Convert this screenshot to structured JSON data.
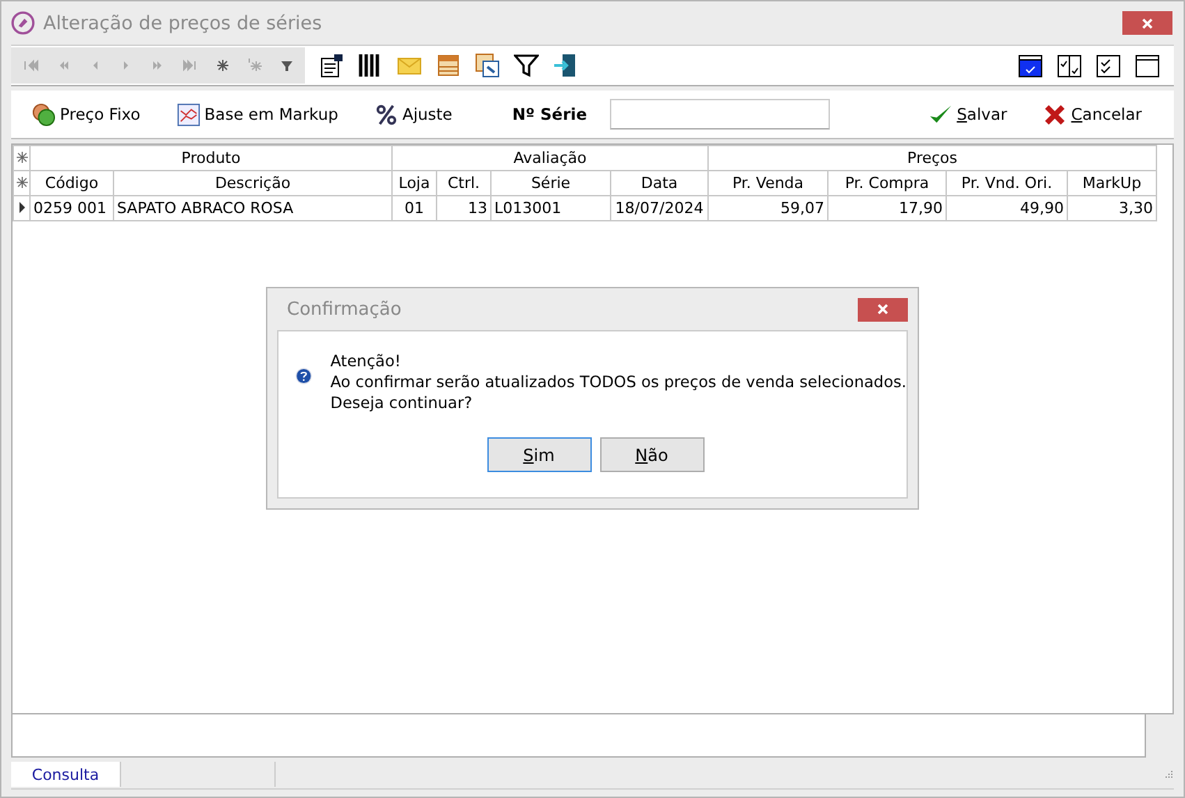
{
  "window": {
    "title": "Alteração de preços de séries"
  },
  "actions": [
    {
      "label": "Preço Fixo",
      "kind": "coins"
    },
    {
      "label": "Base em Markup",
      "kind": "chart"
    },
    {
      "label": "Ajuste",
      "kind": "percent"
    }
  ],
  "serial_field": {
    "label": "Nº Série"
  },
  "commit": [
    {
      "label": "Salvar",
      "kind": "save"
    },
    {
      "label": "Cancelar",
      "kind": "cancel"
    }
  ],
  "table": {
    "groups": [
      {
        "label": "Produto",
        "columns": [
          {
            "label": "Código"
          },
          {
            "label": "Descrição"
          }
        ]
      },
      {
        "label": "Avaliação",
        "columns": [
          {
            "label": "Loja"
          },
          {
            "label": "Ctrl."
          },
          {
            "label": "Série"
          },
          {
            "label": "Data"
          }
        ]
      },
      {
        "label": "Preços",
        "columns": [
          {
            "label": "Pr. Venda"
          },
          {
            "label": "Pr. Compra"
          },
          {
            "label": "Pr. Vnd. Ori."
          },
          {
            "label": "MarkUp"
          }
        ]
      }
    ],
    "rows": [
      {
        "selected": true,
        "cells": [
          "0259 001",
          "SAPATO ABRACO ROSA",
          "01",
          "13",
          "L013001",
          "18/07/2024",
          "59,07",
          "17,90",
          "49,90",
          "3,30"
        ]
      }
    ]
  },
  "status_bar": {
    "tabs": [
      {
        "label": "Consulta",
        "selected": true
      }
    ]
  },
  "dialog": {
    "title": "Confirmação",
    "lines": [
      "Atenção!",
      "Ao confirmar serão atualizados TODOS os preços de venda selecionados.",
      "Deseja continuar?"
    ],
    "buttons": [
      {
        "label": "Sim",
        "default": true
      },
      {
        "label": "Não",
        "default": false
      }
    ]
  }
}
